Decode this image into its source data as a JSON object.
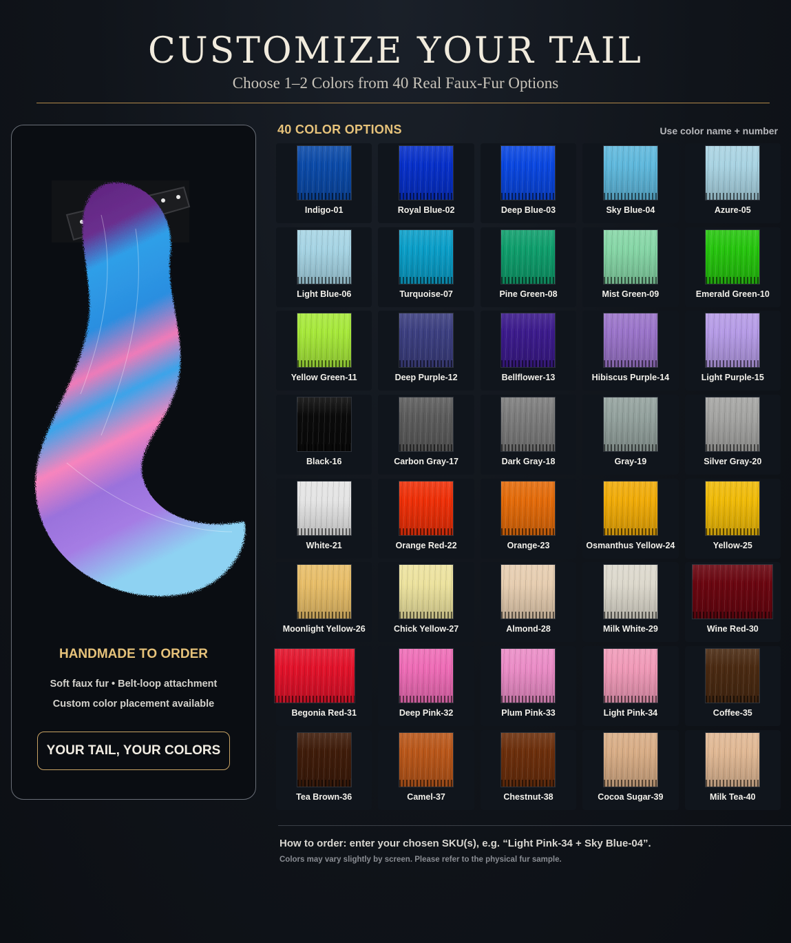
{
  "header": {
    "title": "CUSTOMIZE YOUR TAIL",
    "subtitle": "Choose 1–2 Colors from 40 Real Faux-Fur Options"
  },
  "left_panel": {
    "heading": "HANDMADE TO ORDER",
    "features": [
      "Soft faux fur • Belt-loop attachment",
      "Custom color placement available"
    ],
    "cta": "YOUR TAIL, YOUR COLORS"
  },
  "options": {
    "heading": "40 COLOR OPTIONS",
    "hint": "Use color name + number",
    "colors": [
      {
        "name": "Indigo-01",
        "hex": "#0b4aa8"
      },
      {
        "name": "Royal Blue-02",
        "hex": "#0730c9"
      },
      {
        "name": "Deep Blue-03",
        "hex": "#0a47e0"
      },
      {
        "name": "Sky Blue-04",
        "hex": "#5fb8dc"
      },
      {
        "name": "Azure-05",
        "hex": "#a9d3e2"
      },
      {
        "name": "Light Blue-06",
        "hex": "#a6d4e4"
      },
      {
        "name": "Turquoise-07",
        "hex": "#0a9ec8"
      },
      {
        "name": "Pine Green-08",
        "hex": "#0f9e6c"
      },
      {
        "name": "Mist Green-09",
        "hex": "#86d6a6"
      },
      {
        "name": "Emerald Green-10",
        "hex": "#26c50e"
      },
      {
        "name": "Yellow Green-11",
        "hex": "#a6e83a"
      },
      {
        "name": "Deep Purple-12",
        "hex": "#3c3f80"
      },
      {
        "name": "Bellflower-13",
        "hex": "#3c1b8c"
      },
      {
        "name": "Hibiscus Purple-14",
        "hex": "#9a74c9"
      },
      {
        "name": "Light Purple-15",
        "hex": "#b59be6"
      },
      {
        "name": "Black-16",
        "hex": "#0a0a0a"
      },
      {
        "name": "Carbon Gray-17",
        "hex": "#5c5c5c"
      },
      {
        "name": "Dark Gray-18",
        "hex": "#7c7c7c"
      },
      {
        "name": "Gray-19",
        "hex": "#93a19d"
      },
      {
        "name": "Silver Gray-20",
        "hex": "#a4a4a2"
      },
      {
        "name": "White-21",
        "hex": "#e4e4e4"
      },
      {
        "name": "Orange Red-22",
        "hex": "#ee3008"
      },
      {
        "name": "Orange-23",
        "hex": "#e36b0a"
      },
      {
        "name": "Osmanthus Yellow-24",
        "hex": "#f0ab08"
      },
      {
        "name": "Yellow-25",
        "hex": "#efba08"
      },
      {
        "name": "Moonlight Yellow-26",
        "hex": "#e7bd68"
      },
      {
        "name": "Chick Yellow-27",
        "hex": "#ece29e"
      },
      {
        "name": "Almond-28",
        "hex": "#e6cdb0"
      },
      {
        "name": "Milk White-29",
        "hex": "#dcd8cc"
      },
      {
        "name": "Wine Red-30",
        "hex": "#6a0610"
      },
      {
        "name": "Begonia Red-31",
        "hex": "#e2122a"
      },
      {
        "name": "Deep Pink-32",
        "hex": "#ee6cb6"
      },
      {
        "name": "Plum Pink-33",
        "hex": "#ea8cc6"
      },
      {
        "name": "Light Pink-34",
        "hex": "#f09ab8"
      },
      {
        "name": "Coffee-35",
        "hex": "#4a2a12"
      },
      {
        "name": "Tea Brown-36",
        "hex": "#3f1c0a"
      },
      {
        "name": "Camel-37",
        "hex": "#b9571a"
      },
      {
        "name": "Chestnut-38",
        "hex": "#6c2f0c"
      },
      {
        "name": "Cocoa Sugar-39",
        "hex": "#d8ad86"
      },
      {
        "name": "Milk Tea-40",
        "hex": "#e0b894"
      }
    ]
  },
  "footer": {
    "howto": "How to order: enter your chosen SKU(s), e.g. “Light Pink-34 + Sky Blue-04”.",
    "disclaimer": "Colors may vary slightly by screen. Please refer to the physical fur sample."
  },
  "accent_color": "#e6c27a"
}
